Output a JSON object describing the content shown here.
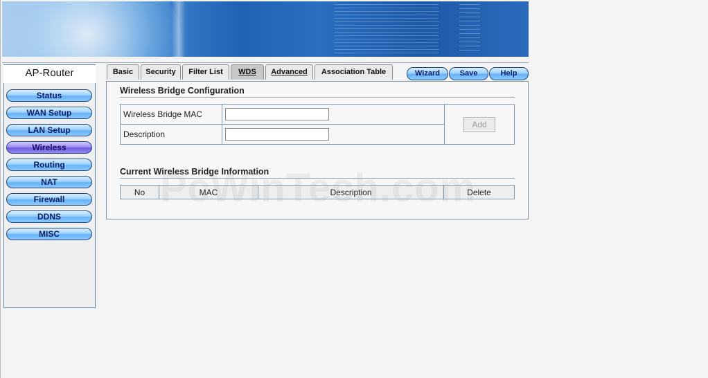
{
  "sidebar": {
    "title": "AP-Router",
    "items": [
      {
        "label": "Status"
      },
      {
        "label": "WAN Setup"
      },
      {
        "label": "LAN Setup"
      },
      {
        "label": "Wireless"
      },
      {
        "label": "Routing"
      },
      {
        "label": "NAT"
      },
      {
        "label": "Firewall"
      },
      {
        "label": "DDNS"
      },
      {
        "label": "MISC"
      }
    ],
    "active": "Wireless"
  },
  "tabs": [
    {
      "label": "Basic"
    },
    {
      "label": "Security"
    },
    {
      "label": "Filter List"
    },
    {
      "label": "WDS"
    },
    {
      "label": "Advanced"
    },
    {
      "label": "Association Table"
    }
  ],
  "active_tab": "WDS",
  "top_buttons": {
    "wizard": "Wizard",
    "save": "Save",
    "help": "Help"
  },
  "config": {
    "title": "Wireless Bridge Configuration",
    "mac_label": "Wireless Bridge MAC",
    "mac_value": "",
    "description_label": "Description",
    "description_value": "",
    "add_label": "Add"
  },
  "info": {
    "title": "Current Wireless Bridge Information",
    "columns": [
      "No",
      "MAC",
      "Description",
      "Delete"
    ]
  },
  "watermark": "PcWinTech.com"
}
